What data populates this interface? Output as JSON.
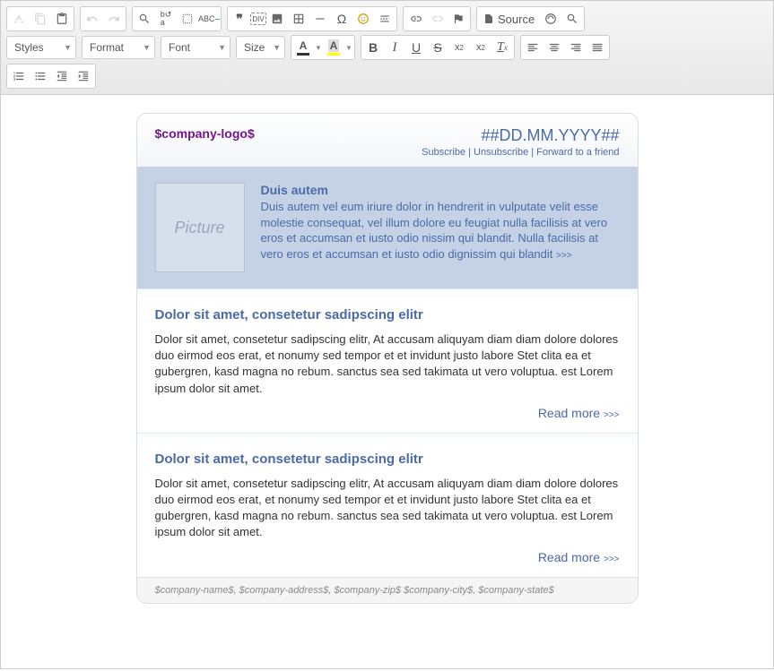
{
  "toolbar": {
    "combos": {
      "styles": "Styles",
      "format": "Format",
      "font": "Font",
      "size": "Size"
    },
    "source_label": "Source"
  },
  "newsletter": {
    "logo": "$company-logo$",
    "date": "##DD.MM.YYYY##",
    "links": {
      "subscribe": "Subscribe",
      "unsubscribe": "Unsubscribe",
      "forward": "Forward to a friend"
    },
    "feature": {
      "picture_label": "Picture",
      "title": "Duis autem",
      "body": "Duis autem vel eum iriure dolor in hendrerit in vulputate velit esse molestie consequat, vel illum dolore eu feugiat nulla facilisis at vero eros et accumsan et iusto odio nissim qui blandit. Nulla facilisis at vero eros et accumsan et iusto odio dignissim qui blandit",
      "more": ">>>"
    },
    "articles": [
      {
        "title": "Dolor sit amet, consetetur sadipscing elitr",
        "body": "Dolor sit amet, consetetur sadipscing elitr, At accusam aliquyam diam diam dolore dolores duo eirmod eos erat, et nonumy sed tempor et et invidunt justo labore Stet clita ea et gubergren, kasd magna no rebum. sanctus sea sed takimata ut vero voluptua. est Lorem ipsum dolor sit amet.",
        "readmore": "Read more",
        "more": ">>>"
      },
      {
        "title": "Dolor sit amet, consetetur sadipscing elitr",
        "body": "Dolor sit amet, consetetur sadipscing elitr, At accusam aliquyam diam diam dolore dolores duo eirmod eos erat, et nonumy sed tempor et et invidunt justo labore Stet clita ea et gubergren, kasd magna no rebum. sanctus sea sed takimata ut vero voluptua. est Lorem ipsum dolor sit amet.",
        "readmore": "Read more",
        "more": ">>>"
      }
    ],
    "footer": "$company-name$, $company-address$, $company-zip$ $company-city$, $company-state$"
  }
}
